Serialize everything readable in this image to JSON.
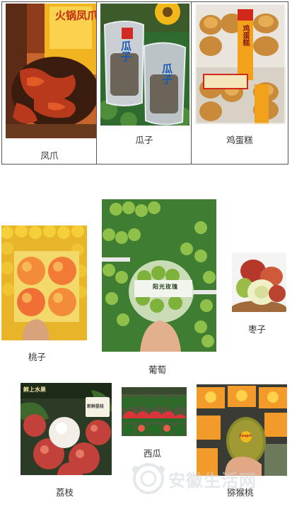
{
  "top_row": [
    {
      "caption": "凤爪",
      "package_text": "火锅凤爪"
    },
    {
      "caption": "瓜子",
      "package_text": "瓜子"
    },
    {
      "caption": "鸡蛋糕",
      "package_text": "鸡蛋糕"
    }
  ],
  "fruits": {
    "peach": {
      "caption": "桃子"
    },
    "grape": {
      "caption": "葡萄",
      "package_text": "阳光玫瑰"
    },
    "jujube": {
      "caption": "枣子"
    },
    "lychee": {
      "caption": "荔枝",
      "sign_text": "鲜上水果",
      "tag_text": "新鲜荔枝"
    },
    "watermelon": {
      "caption": "西瓜"
    },
    "kiwi": {
      "caption": "猕猴桃",
      "sticker_text": "Zespri"
    }
  },
  "watermark": {
    "text": "安徽生活网"
  },
  "colors": {
    "border": "#555555",
    "caption": "#333333",
    "watermark": "#cfd6dc"
  }
}
